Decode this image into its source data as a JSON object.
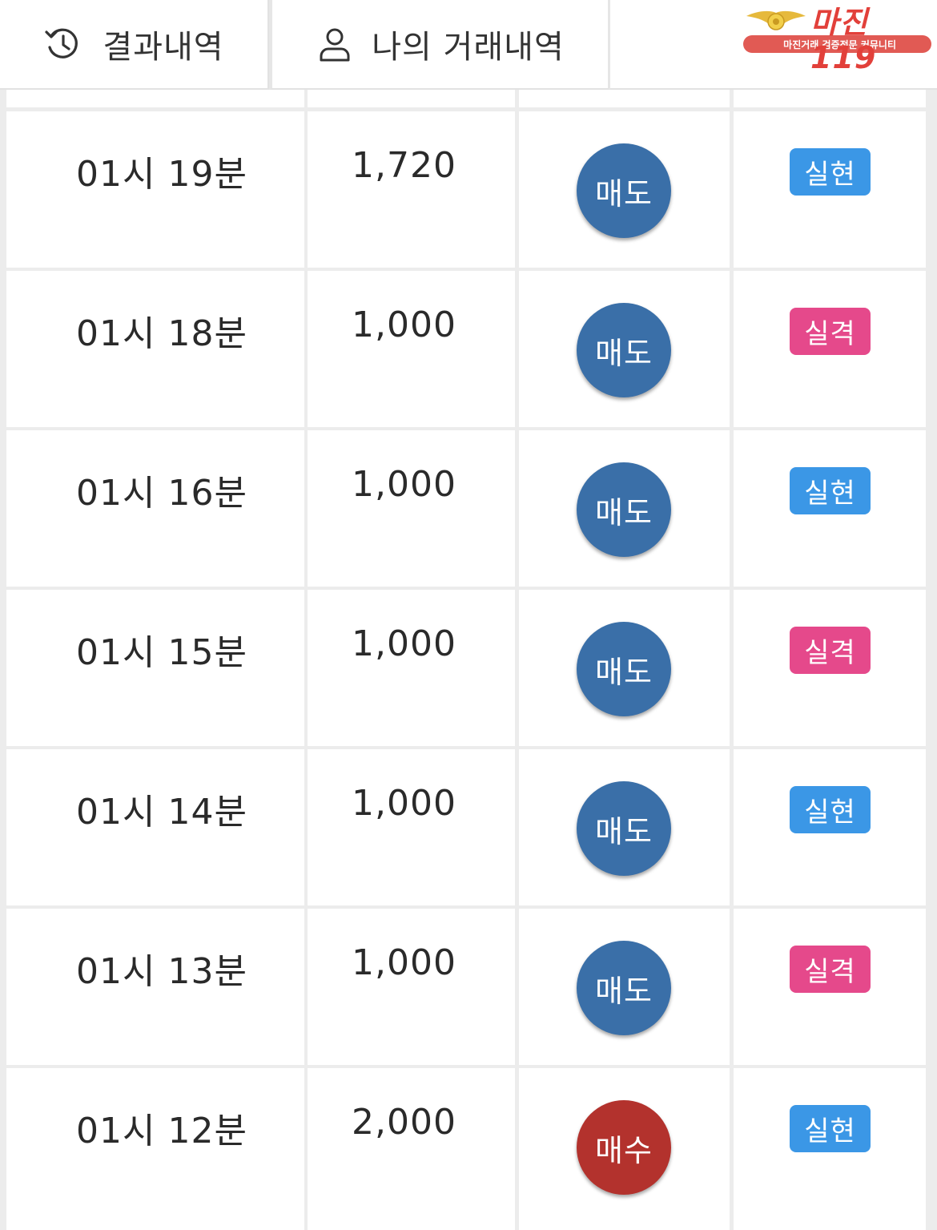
{
  "tabs": [
    {
      "label": "결과내역",
      "icon": "history-icon"
    },
    {
      "label": "나의 거래내역",
      "icon": "user-icon"
    }
  ],
  "logo": {
    "name": "마진119",
    "tagline": "마진거래 검증전문 커뮤니티"
  },
  "rows": [
    {
      "time": "01시 19분",
      "amount": "1,720",
      "side": "매도",
      "side_type": "sell",
      "result": "실현",
      "result_type": "win"
    },
    {
      "time": "01시 18분",
      "amount": "1,000",
      "side": "매도",
      "side_type": "sell",
      "result": "실격",
      "result_type": "lose"
    },
    {
      "time": "01시 16분",
      "amount": "1,000",
      "side": "매도",
      "side_type": "sell",
      "result": "실현",
      "result_type": "win"
    },
    {
      "time": "01시 15분",
      "amount": "1,000",
      "side": "매도",
      "side_type": "sell",
      "result": "실격",
      "result_type": "lose"
    },
    {
      "time": "01시 14분",
      "amount": "1,000",
      "side": "매도",
      "side_type": "sell",
      "result": "실현",
      "result_type": "win"
    },
    {
      "time": "01시 13분",
      "amount": "1,000",
      "side": "매도",
      "side_type": "sell",
      "result": "실격",
      "result_type": "lose"
    },
    {
      "time": "01시 12분",
      "amount": "2,000",
      "side": "매수",
      "side_type": "buy",
      "result": "실현",
      "result_type": "win"
    }
  ],
  "colors": {
    "sell": "#3a6fa8",
    "buy": "#b3322d",
    "win": "#3b97e6",
    "lose": "#e5498b"
  }
}
